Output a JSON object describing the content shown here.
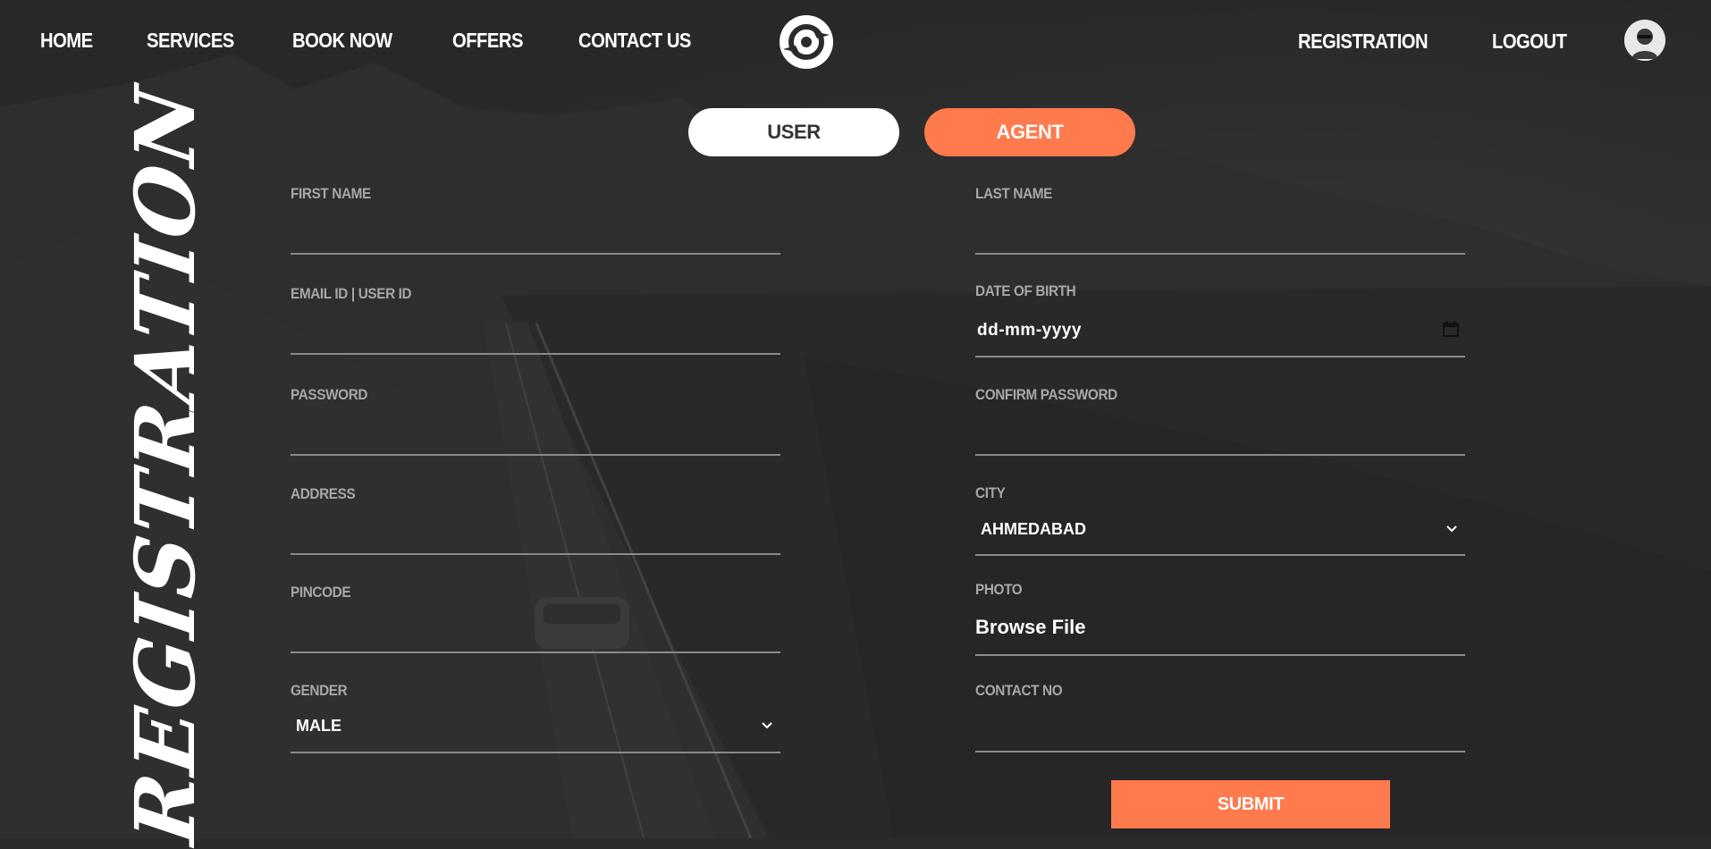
{
  "nav": {
    "left": [
      "HOME",
      "SERVICES",
      "BOOK NOW",
      "OFFERS",
      "CONTACT US"
    ],
    "right": [
      "REGISTRATION",
      "LOGOUT"
    ]
  },
  "toggle": {
    "user": "USER",
    "agent": "AGENT"
  },
  "side_title": "REGISTRATION",
  "form": {
    "first_name": {
      "label": "FIRST NAME",
      "value": ""
    },
    "last_name": {
      "label": "LAST NAME",
      "value": ""
    },
    "email": {
      "label": "EMAIL ID | USER ID",
      "value": ""
    },
    "dob": {
      "label": "DATE OF BIRTH",
      "placeholder": "dd-mm-yyyy"
    },
    "password": {
      "label": "PASSWORD",
      "value": ""
    },
    "confirm_password": {
      "label": "CONFIRM PASSWORD",
      "value": ""
    },
    "address": {
      "label": "ADDRESS",
      "value": ""
    },
    "city": {
      "label": "CITY",
      "selected": "AHMEDABAD"
    },
    "pincode": {
      "label": "PINCODE",
      "value": ""
    },
    "photo": {
      "label": "PHOTO",
      "button": "Browse File"
    },
    "gender": {
      "label": "GENDER",
      "selected": "MALE"
    },
    "contact": {
      "label": "CONTACT NO",
      "value": ""
    }
  },
  "submit_label": "SUBMIT",
  "colors": {
    "accent": "#ff7a4d",
    "background": "#2b2b2b",
    "label": "#a7a7a7"
  }
}
